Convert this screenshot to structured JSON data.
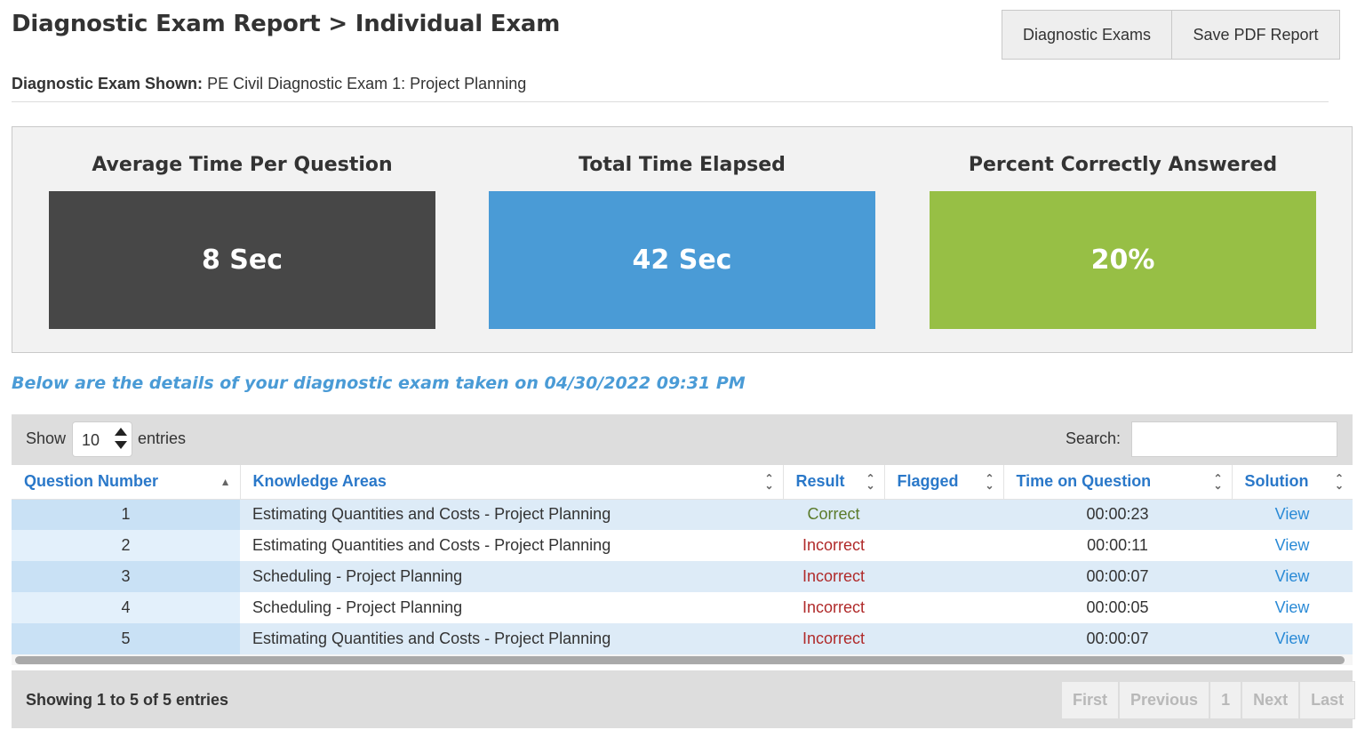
{
  "header": {
    "title": "Diagnostic Exam Report > Individual Exam",
    "buttons": {
      "exams": "Diagnostic Exams",
      "pdf": "Save PDF Report"
    },
    "exam_shown_label": "Diagnostic Exam Shown:",
    "exam_shown_value": "PE Civil Diagnostic Exam 1: Project Planning"
  },
  "stats": [
    {
      "title": "Average Time Per Question",
      "value": "8 Sec",
      "color": "#474747"
    },
    {
      "title": "Total Time Elapsed",
      "value": "42 Sec",
      "color": "#4a9bd6"
    },
    {
      "title": "Percent Correctly Answered",
      "value": "20%",
      "color": "#97bf45"
    }
  ],
  "details_line": "Below are the details of your diagnostic exam taken on 04/30/2022 09:31 PM",
  "table": {
    "show_label": "Show",
    "page_length": "10",
    "entries_label": "entries",
    "search_label": "Search:",
    "search_value": "",
    "columns": [
      "Question Number",
      "Knowledge Areas",
      "Result",
      "Flagged",
      "Time on Question",
      "Solution"
    ],
    "rows": [
      {
        "q": "1",
        "area": "Estimating Quantities and Costs - Project Planning",
        "result": "Correct",
        "flagged": "",
        "time": "00:00:23",
        "solution": "View"
      },
      {
        "q": "2",
        "area": "Estimating Quantities and Costs - Project Planning",
        "result": "Incorrect",
        "flagged": "",
        "time": "00:00:11",
        "solution": "View"
      },
      {
        "q": "3",
        "area": "Scheduling - Project Planning",
        "result": "Incorrect",
        "flagged": "",
        "time": "00:00:07",
        "solution": "View"
      },
      {
        "q": "4",
        "area": "Scheduling - Project Planning",
        "result": "Incorrect",
        "flagged": "",
        "time": "00:00:05",
        "solution": "View"
      },
      {
        "q": "5",
        "area": "Estimating Quantities and Costs - Project Planning",
        "result": "Incorrect",
        "flagged": "",
        "time": "00:00:07",
        "solution": "View"
      }
    ],
    "info": "Showing 1 to 5 of 5 entries",
    "pagination": {
      "first": "First",
      "previous": "Previous",
      "page": "1",
      "next": "Next",
      "last": "Last"
    }
  }
}
